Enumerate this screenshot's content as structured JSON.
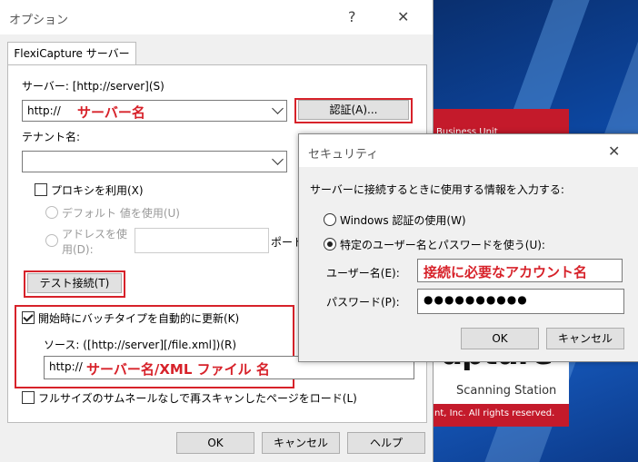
{
  "main_dialog": {
    "title": "オプション",
    "help_glyph": "?",
    "close_glyph": "✕",
    "tab_label": "FlexiCapture サーバー",
    "server_label": "サーバー: [http://server](S)",
    "server_value": "http://",
    "server_annotation": "サーバー名",
    "auth_button": "認証(A)...",
    "tenant_label": "テナント名:",
    "proxy_checkbox": "プロキシを利用(X)",
    "default_radio": "デフォルト 値を使用(U)",
    "address_radio_line1": "アドレスを使",
    "address_radio_line2": "用(D):",
    "port_label": "ポート",
    "test_button": "テスト接続(T)",
    "auto_update_checkbox": "開始時にバッチタイプを自動的に更新(K)",
    "source_label": "ソース: ([http://server][/file.xml])(R)",
    "source_value": "http://",
    "source_annotation": "サーバー名/XML ファイル 名",
    "fullsize_checkbox": "フルサイズのサムネールなしで再スキャンしたページをロード(L)",
    "ok_button": "OK",
    "cancel_button": "キャンセル",
    "help_button": "ヘルプ"
  },
  "security_dialog": {
    "title": "セキュリティ",
    "close_glyph": "✕",
    "prompt": "サーバーに接続するときに使用する情報を入力する:",
    "windows_auth_radio": "Windows 認証の使用(W)",
    "specific_user_radio": "特定のユーザー名とパスワードを使う(U):",
    "username_label": "ユーザー名(E):",
    "username_annotation": "接続に必要なアカウント名",
    "password_label": "パスワード(P):",
    "password_value": "●●●●●●●●●●",
    "ok_button": "OK",
    "cancel_button": "キャンセル"
  },
  "splash": {
    "top_text": "Business Unit",
    "logo_text": "apture",
    "subtitle": "Scanning Station",
    "copyright": "nt, Inc. All rights reserved."
  },
  "colors": {
    "annotation_red": "#d7222a",
    "splash_red": "#c41a2b",
    "desktop_blue": "#0d4aa8"
  }
}
